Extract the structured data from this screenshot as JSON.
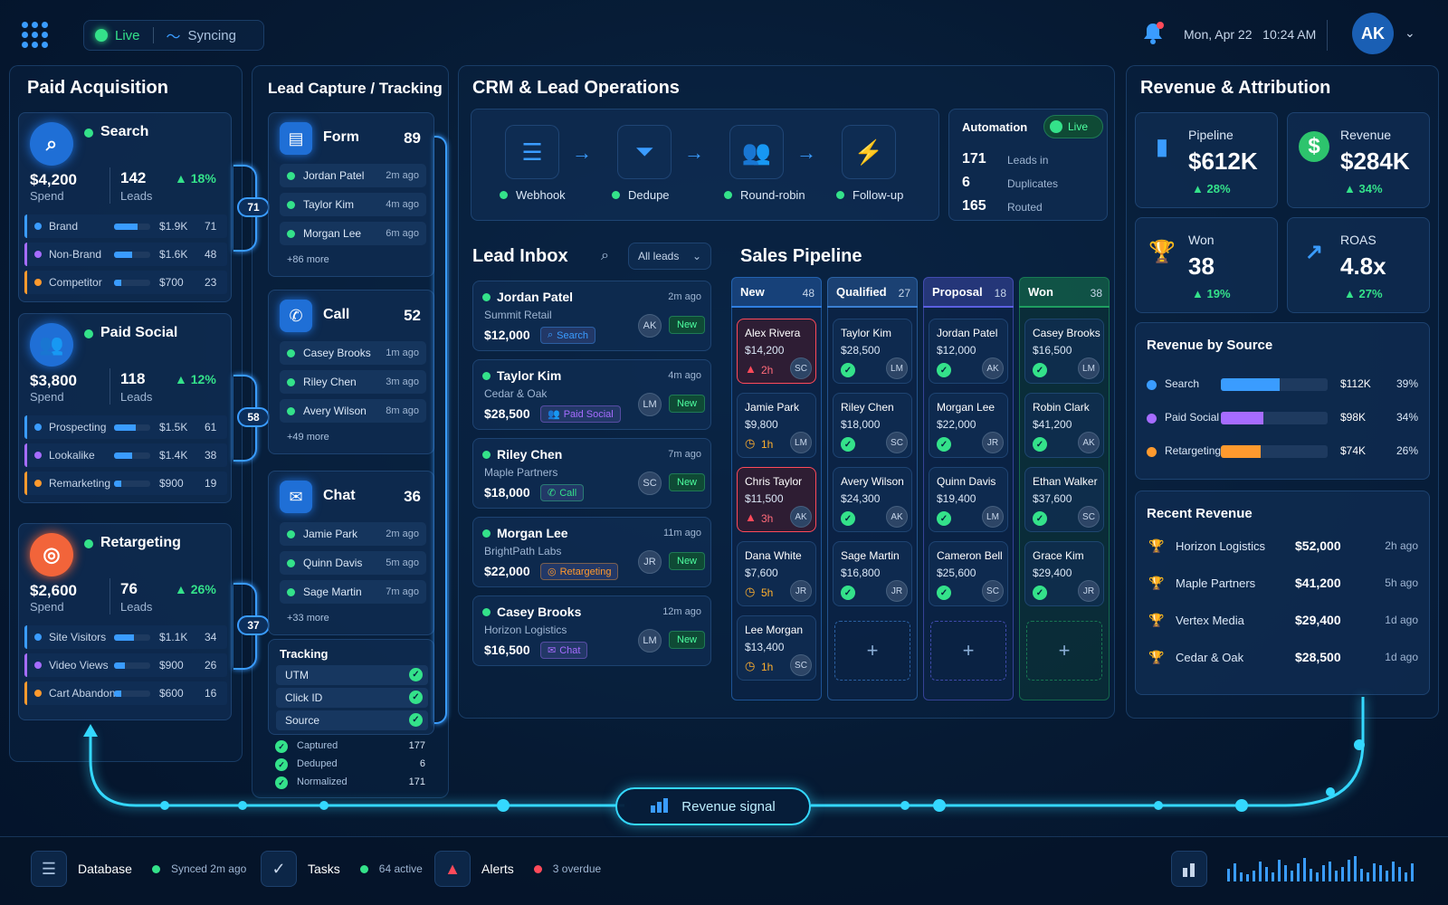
{
  "topbar": {
    "live": "Live",
    "syncing": "Syncing",
    "datetime": "Mon, Apr 22   10:24 AM",
    "avatar": "AK"
  },
  "paid": {
    "title": "Paid Acquisition",
    "channels": [
      {
        "name": "Search",
        "spend": "$4,200",
        "spend_label": "Spend",
        "leads": "142",
        "leads_label": "Leads",
        "change": "▲ 18%",
        "color": "#1f6fd6",
        "icon": "search-icon",
        "rows": [
          {
            "n": "Brand",
            "v": "$1.9K",
            "c": "71",
            "f": 0.65,
            "col": "#3a9cff"
          },
          {
            "n": "Non-Brand",
            "v": "$1.6K",
            "c": "48",
            "f": 0.5,
            "col": "#a66cff"
          },
          {
            "n": "Competitor",
            "v": "$700",
            "c": "23",
            "f": 0.2,
            "col": "#ff9a2e"
          }
        ]
      },
      {
        "name": "Paid Social",
        "spend": "$3,800",
        "spend_label": "Spend",
        "leads": "118",
        "leads_label": "Leads",
        "change": "▲ 12%",
        "color": "#1f6fd6",
        "icon": "users-icon",
        "rows": [
          {
            "n": "Prospecting",
            "v": "$1.5K",
            "c": "61",
            "f": 0.6,
            "col": "#3a9cff"
          },
          {
            "n": "Lookalike",
            "v": "$1.4K",
            "c": "38",
            "f": 0.5,
            "col": "#a66cff"
          },
          {
            "n": "Remarketing",
            "v": "$900",
            "c": "19",
            "f": 0.2,
            "col": "#ff9a2e"
          }
        ]
      },
      {
        "name": "Retargeting",
        "spend": "$2,600",
        "spend_label": "Spend",
        "leads": "76",
        "leads_label": "Leads",
        "change": "▲ 26%",
        "color": "#f2643a",
        "icon": "target-icon",
        "rows": [
          {
            "n": "Site Visitors",
            "v": "$1.1K",
            "c": "34",
            "f": 0.55,
            "col": "#3a9cff"
          },
          {
            "n": "Video Views",
            "v": "$900",
            "c": "26",
            "f": 0.3,
            "col": "#a66cff"
          },
          {
            "n": "Cart Abandon",
            "v": "$600",
            "c": "16",
            "f": 0.2,
            "col": "#ff9a2e"
          }
        ]
      }
    ],
    "connectors": [
      "71",
      "58",
      "37"
    ]
  },
  "capture": {
    "title": "Lead Capture / Tracking",
    "groups": [
      {
        "name": "Form",
        "count": "89",
        "icon": "form-icon",
        "items": [
          {
            "n": "Jordan Patel",
            "t": "2m ago"
          },
          {
            "n": "Taylor Kim",
            "t": "4m ago"
          },
          {
            "n": "Morgan Lee",
            "t": "6m ago"
          }
        ],
        "more": "+86 more"
      },
      {
        "name": "Call",
        "count": "52",
        "icon": "phone-icon",
        "items": [
          {
            "n": "Casey Brooks",
            "t": "1m ago"
          },
          {
            "n": "Riley Chen",
            "t": "3m ago"
          },
          {
            "n": "Avery Wilson",
            "t": "8m ago"
          }
        ],
        "more": "+49 more"
      },
      {
        "name": "Chat",
        "count": "36",
        "icon": "chat-icon",
        "items": [
          {
            "n": "Jamie Park",
            "t": "2m ago"
          },
          {
            "n": "Quinn Davis",
            "t": "5m ago"
          },
          {
            "n": "Sage Martin",
            "t": "7m ago"
          }
        ],
        "more": "+33 more"
      }
    ],
    "tracking": {
      "title": "Tracking",
      "items": [
        "UTM",
        "Click ID",
        "Source"
      ]
    },
    "stats": [
      {
        "n": "Captured",
        "v": "177"
      },
      {
        "n": "Deduped",
        "v": "6"
      },
      {
        "n": "Normalized",
        "v": "171"
      }
    ]
  },
  "crm": {
    "title": "CRM & Lead Operations",
    "steps": [
      "Webhook",
      "Dedupe",
      "Round-robin",
      "Follow-up"
    ],
    "automation": {
      "title": "Automation",
      "badge": "Live",
      "rows": [
        {
          "v": "171",
          "n": "Leads in"
        },
        {
          "v": "6",
          "n": "Duplicates"
        },
        {
          "v": "165",
          "n": "Routed"
        }
      ]
    }
  },
  "inbox": {
    "title": "Lead Inbox",
    "filter": "All leads",
    "leads": [
      {
        "n": "Jordan Patel",
        "co": "Summit Retail",
        "amt": "$12,000",
        "src": "Search",
        "t": "2m ago",
        "av": "AK",
        "badge": "New",
        "scol": "#3a9cff"
      },
      {
        "n": "Taylor Kim",
        "co": "Cedar & Oak",
        "amt": "$28,500",
        "src": "Paid Social",
        "t": "4m ago",
        "av": "LM",
        "badge": "New",
        "scol": "#a66cff"
      },
      {
        "n": "Riley Chen",
        "co": "Maple Partners",
        "amt": "$18,000",
        "src": "Call",
        "t": "7m ago",
        "av": "SC",
        "badge": "New",
        "scol": "#34e28a"
      },
      {
        "n": "Morgan Lee",
        "co": "BrightPath Labs",
        "amt": "$22,000",
        "src": "Retargeting",
        "t": "11m ago",
        "av": "JR",
        "badge": "New",
        "scol": "#ff9a2e"
      },
      {
        "n": "Casey Brooks",
        "co": "Horizon Logistics",
        "amt": "$16,500",
        "src": "Chat",
        "t": "12m ago",
        "av": "LM",
        "badge": "New",
        "scol": "#a66cff"
      }
    ]
  },
  "pipeline": {
    "title": "Sales Pipeline",
    "cols": [
      {
        "name": "New",
        "count": "48",
        "color": "#2f7fe0",
        "cards": [
          {
            "n": "Alex Rivera",
            "v": "$14,200",
            "s": "2h",
            "st": "alert",
            "av": "SC"
          },
          {
            "n": "Jamie Park",
            "v": "$9,800",
            "s": "1h",
            "st": "clock",
            "av": "LM"
          },
          {
            "n": "Chris Taylor",
            "v": "$11,500",
            "s": "3h",
            "st": "alert",
            "av": "AK"
          },
          {
            "n": "Dana White",
            "v": "$7,600",
            "s": "5h",
            "st": "clock",
            "av": "JR"
          },
          {
            "n": "Lee Morgan",
            "v": "$13,400",
            "s": "1h",
            "st": "clock",
            "av": "SC"
          }
        ]
      },
      {
        "name": "Qualified",
        "count": "27",
        "color": "#3b7fd0",
        "cards": [
          {
            "n": "Taylor Kim",
            "v": "$28,500",
            "st": "ok",
            "av": "LM"
          },
          {
            "n": "Riley Chen",
            "v": "$18,000",
            "st": "ok",
            "av": "SC"
          },
          {
            "n": "Avery Wilson",
            "v": "$24,300",
            "st": "ok",
            "av": "AK"
          },
          {
            "n": "Sage Martin",
            "v": "$16,800",
            "st": "ok",
            "av": "JR"
          }
        ]
      },
      {
        "name": "Proposal",
        "count": "18",
        "color": "#5b5fe0",
        "cards": [
          {
            "n": "Jordan Patel",
            "v": "$12,000",
            "st": "ok",
            "av": "AK"
          },
          {
            "n": "Morgan Lee",
            "v": "$22,000",
            "st": "ok",
            "av": "JR"
          },
          {
            "n": "Quinn Davis",
            "v": "$19,400",
            "st": "ok",
            "av": "LM"
          },
          {
            "n": "Cameron Bell",
            "v": "$25,600",
            "st": "ok",
            "av": "SC"
          }
        ]
      },
      {
        "name": "Won",
        "count": "38",
        "color": "#1f9e60",
        "cards": [
          {
            "n": "Casey Brooks",
            "v": "$16,500",
            "st": "ok",
            "av": "LM"
          },
          {
            "n": "Robin Clark",
            "v": "$41,200",
            "st": "ok",
            "av": "AK"
          },
          {
            "n": "Ethan Walker",
            "v": "$37,600",
            "st": "ok",
            "av": "SC"
          },
          {
            "n": "Grace Kim",
            "v": "$29,400",
            "st": "ok",
            "av": "JR"
          }
        ]
      }
    ]
  },
  "revenue": {
    "title": "Revenue & Attribution",
    "kpis": [
      {
        "n": "Pipeline",
        "v": "$612K",
        "c": "▲ 28%",
        "icon": "bar-chart-icon"
      },
      {
        "n": "Revenue",
        "v": "$284K",
        "c": "▲ 34%",
        "icon": "dollar-icon"
      },
      {
        "n": "Won",
        "v": "38",
        "c": "▲ 19%",
        "icon": "trophy-icon"
      },
      {
        "n": "ROAS",
        "v": "4.8x",
        "c": "▲ 27%",
        "icon": "trend-icon"
      }
    ],
    "by_source": {
      "title": "Revenue by Source",
      "rows": [
        {
          "n": "Search",
          "v": "$112K",
          "p": "39%",
          "f": 0.55,
          "col": "#3a9cff"
        },
        {
          "n": "Paid Social",
          "v": "$98K",
          "p": "34%",
          "f": 0.4,
          "col": "#a66cff"
        },
        {
          "n": "Retargeting",
          "v": "$74K",
          "p": "26%",
          "f": 0.37,
          "col": "#ff9a2e"
        }
      ]
    },
    "recent": {
      "title": "Recent Revenue",
      "rows": [
        {
          "n": "Horizon Logistics",
          "v": "$52,000",
          "t": "2h ago"
        },
        {
          "n": "Maple Partners",
          "v": "$41,200",
          "t": "5h ago"
        },
        {
          "n": "Vertex Media",
          "v": "$29,400",
          "t": "1d ago"
        },
        {
          "n": "Cedar & Oak",
          "v": "$28,500",
          "t": "1d ago"
        }
      ]
    }
  },
  "signal": {
    "label": "Revenue signal"
  },
  "footer": {
    "db": "Database",
    "db_status": "Synced 2m ago",
    "tasks": "Tasks",
    "tasks_status": "64 active",
    "alerts": "Alerts",
    "alerts_status": "3 overdue"
  }
}
